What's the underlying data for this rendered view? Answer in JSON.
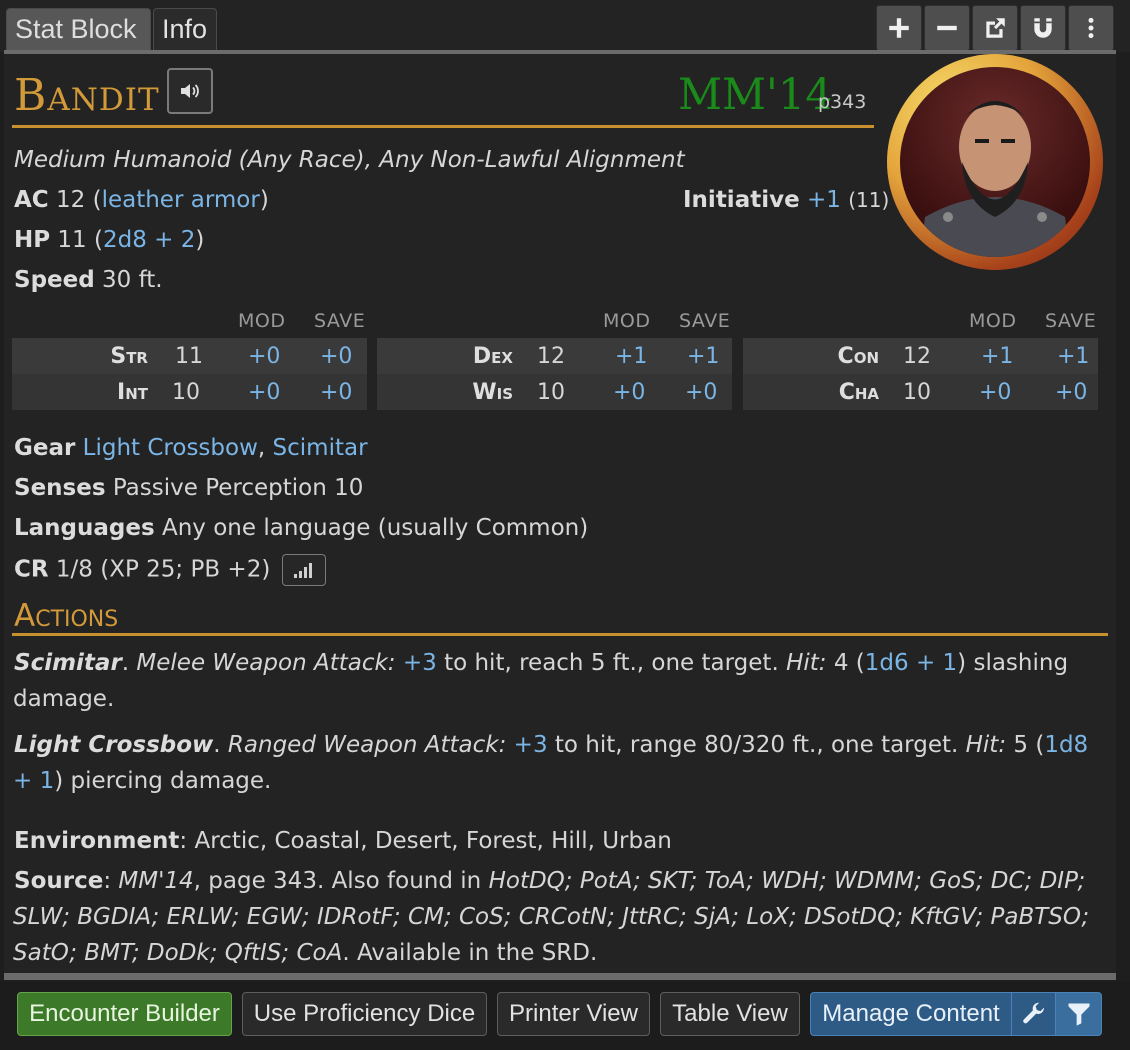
{
  "tabs": {
    "stat_block": "Stat Block",
    "info": "Info"
  },
  "toolbar": {
    "icons": [
      "plus-icon",
      "minus-icon",
      "popout-icon",
      "magnet-icon",
      "more-vertical-icon"
    ]
  },
  "monster": {
    "name": "Bandit",
    "source_abbr": "MM'14",
    "source_page": "p343",
    "type_line": "Medium Humanoid (Any Race), Any Non-Lawful Alignment",
    "ac": {
      "label": "AC",
      "value": "12",
      "open": "(",
      "armor": "leather armor",
      "close": ")"
    },
    "initiative": {
      "label": "Initiative",
      "bonus": "+1",
      "score": "(11)"
    },
    "hp": {
      "label": "HP",
      "value": "11",
      "open": "(",
      "formula": "2d8 + 2",
      "close": ")"
    },
    "speed": {
      "label": "Speed",
      "value": "30 ft."
    },
    "ability_headers": {
      "mod": "MOD",
      "save": "SAVE"
    },
    "abilities": [
      {
        "name": "Str",
        "score": "11",
        "mod": "+0",
        "save": "+0"
      },
      {
        "name": "Int",
        "score": "10",
        "mod": "+0",
        "save": "+0"
      },
      {
        "name": "Dex",
        "score": "12",
        "mod": "+1",
        "save": "+1"
      },
      {
        "name": "Wis",
        "score": "10",
        "mod": "+0",
        "save": "+0"
      },
      {
        "name": "Con",
        "score": "12",
        "mod": "+1",
        "save": "+1"
      },
      {
        "name": "Cha",
        "score": "10",
        "mod": "+0",
        "save": "+0"
      }
    ],
    "gear": {
      "label": "Gear",
      "item1": "Light Crossbow",
      "sep": ",",
      "item2": "Scimitar"
    },
    "senses": {
      "label": "Senses",
      "value": "Passive Perception 10"
    },
    "languages": {
      "label": "Languages",
      "value": "Any one language (usually Common)"
    },
    "cr": {
      "label": "CR",
      "value": "1/8 (XP 25; PB +2)"
    },
    "actions_title": "Actions",
    "actions": [
      {
        "name": "Scimitar",
        "kind": "Melee Weapon Attack:",
        "bonus": "+3",
        "text1": "to hit, reach 5 ft., one target.",
        "hit_label": "Hit:",
        "dmg": "4 (",
        "dice": "1d6 + 1",
        "text2": ") slashing",
        "text3": "damage."
      },
      {
        "name": "Light Crossbow",
        "kind": "Ranged Weapon Attack:",
        "bonus": "+3",
        "text1": "to hit, range 80/320 ft., one target.",
        "hit_label": "Hit:",
        "dmg": "5 (",
        "dice_a": "1d8",
        "dice_b": "+ 1",
        "text2": ") piercing damage."
      }
    ],
    "environment": {
      "label": "Environment",
      "value": "Arctic, Coastal, Desert, Forest, Hill, Urban"
    },
    "source": {
      "label": "Source",
      "line1_ital": "MM'14",
      "line1_text": ", page 343. Also found in",
      "line1_refs": "HotDQ; PotA; SKT; ToA; WDH; WDMM; GoS; DC; DIP;",
      "line2": "SLW; BGDIA; ERLW; EGW; IDRotF; CM; CoS; CRCotN; JttRC; SjA; LoX; DSotDQ; KftGV; PaBTSO;",
      "line3_refs": "SatO; BMT; DoDk; QftIS; CoA",
      "line3_text": ". Available in the SRD."
    }
  },
  "footer": {
    "encounter_builder": "Encounter Builder",
    "proficiency_dice": "Use Proficiency Dice",
    "printer_view": "Printer View",
    "table_view": "Table View",
    "manage_content": "Manage Content"
  },
  "colors": {
    "accent_gold": "#d29a38",
    "link_blue": "#7ab5e6",
    "source_green": "#1a8a1a",
    "button_green": "#3c7a2a",
    "button_blue": "#2e5b86"
  }
}
